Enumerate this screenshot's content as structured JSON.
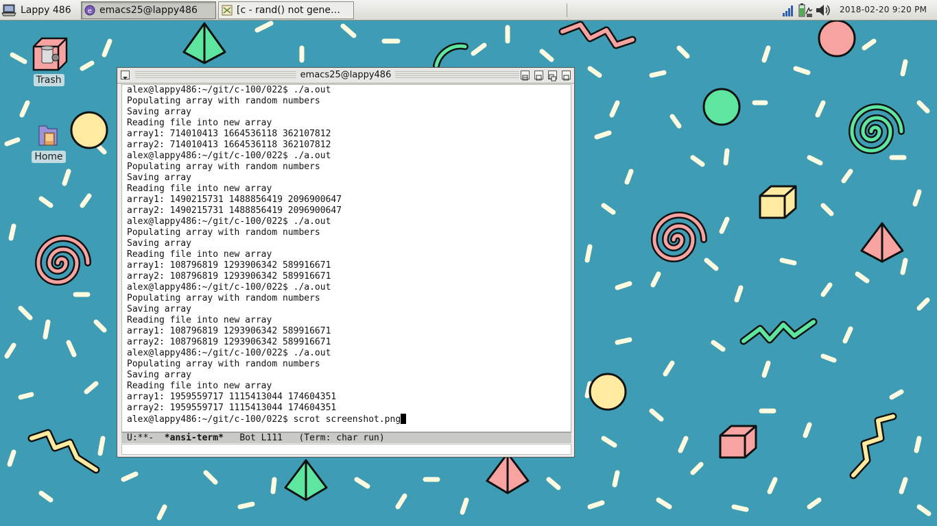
{
  "taskbar": {
    "start_label": "Lappy 486",
    "tasks": [
      {
        "label": "emacs25@lappy486",
        "active": true
      },
      {
        "label": "[c - rand() not gene…",
        "active": false
      }
    ],
    "clock": "2018-02-20   9:20 PM"
  },
  "desktop": {
    "icons": [
      {
        "label": "Trash"
      },
      {
        "label": "Home"
      }
    ]
  },
  "window": {
    "title": "emacs25@lappy486",
    "terminal_lines": [
      "alex@lappy486:~/git/c-100/022$ ./a.out",
      "Populating array with random numbers",
      "Saving array",
      "Reading file into new array",
      "array1: 714010413 1664536118 362107812",
      "array2: 714010413 1664536118 362107812",
      "alex@lappy486:~/git/c-100/022$ ./a.out",
      "Populating array with random numbers",
      "Saving array",
      "Reading file into new array",
      "array1: 1490215731 1488856419 2096900647",
      "array2: 1490215731 1488856419 2096900647",
      "alex@lappy486:~/git/c-100/022$ ./a.out",
      "Populating array with random numbers",
      "Saving array",
      "Reading file into new array",
      "array1: 108796819 1293906342 589916671",
      "array2: 108796819 1293906342 589916671",
      "alex@lappy486:~/git/c-100/022$ ./a.out",
      "Populating array with random numbers",
      "Saving array",
      "Reading file into new array",
      "array1: 108796819 1293906342 589916671",
      "array2: 108796819 1293906342 589916671",
      "alex@lappy486:~/git/c-100/022$ ./a.out",
      "Populating array with random numbers",
      "Saving array",
      "Reading file into new array",
      "array1: 1959559717 1115413044 174604351",
      "array2: 1959559717 1115413044 174604351"
    ],
    "current_line": "alex@lappy486:~/git/c-100/022$ scrot screenshot.png",
    "modeline": {
      "status": "U:**-  ",
      "buffer": "*ansi-term*",
      "position": "   Bot L111   ",
      "mode": "(Term: char run)"
    }
  },
  "colors": {
    "desktop_bg": "#3e9db5",
    "pink": "#f6a3a1",
    "green": "#5ee6a0",
    "yellow": "#ffeaa0",
    "cream": "#fffbe0"
  }
}
